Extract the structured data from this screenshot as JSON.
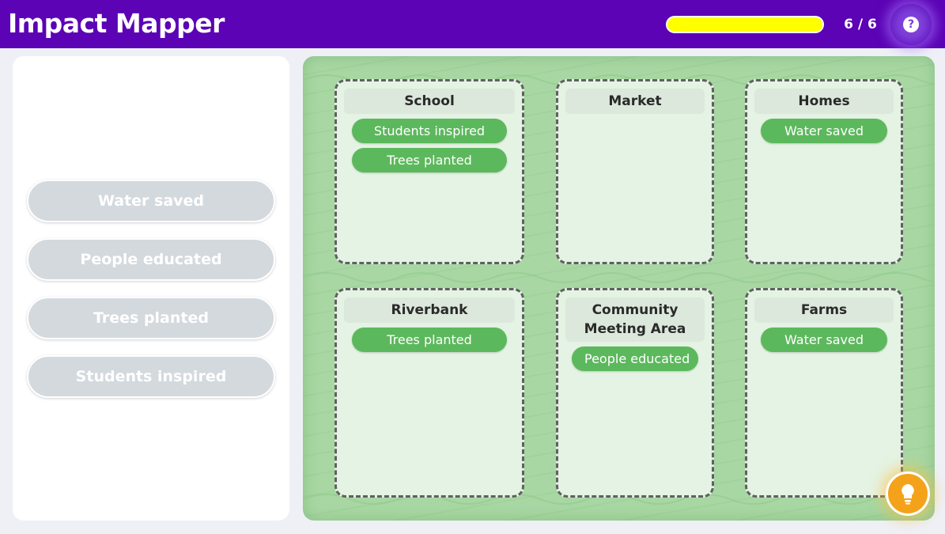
{
  "header": {
    "title": "Impact Mapper",
    "progress": {
      "count_label": "6 / 6",
      "fraction": 1.0
    },
    "help_icon": "question-mark-icon"
  },
  "chip_bank": {
    "chips": [
      {
        "label": "Water saved"
      },
      {
        "label": "People educated"
      },
      {
        "label": "Trees planted"
      },
      {
        "label": "Students inspired"
      }
    ]
  },
  "zones": {
    "school": {
      "title": "School",
      "chips": [
        "Students inspired",
        "Trees planted"
      ]
    },
    "market": {
      "title": "Market",
      "chips": []
    },
    "homes": {
      "title": "Homes",
      "chips": [
        "Water saved"
      ]
    },
    "riverbank": {
      "title": "Riverbank",
      "chips": [
        "Trees planted"
      ]
    },
    "community": {
      "title": "Community Meeting Area",
      "chips": [
        "People educated"
      ]
    },
    "farms": {
      "title": "Farms",
      "chips": [
        "Water saved"
      ]
    }
  },
  "hint": {
    "icon": "lightbulb-icon"
  },
  "colors": {
    "header": "#5b03b5",
    "progress_fill": "#ffff00",
    "chip_green": "#5cb85c",
    "bank_chip": "#d4d9de",
    "board": "#a8d7a3",
    "hint": "#f5a21b"
  }
}
